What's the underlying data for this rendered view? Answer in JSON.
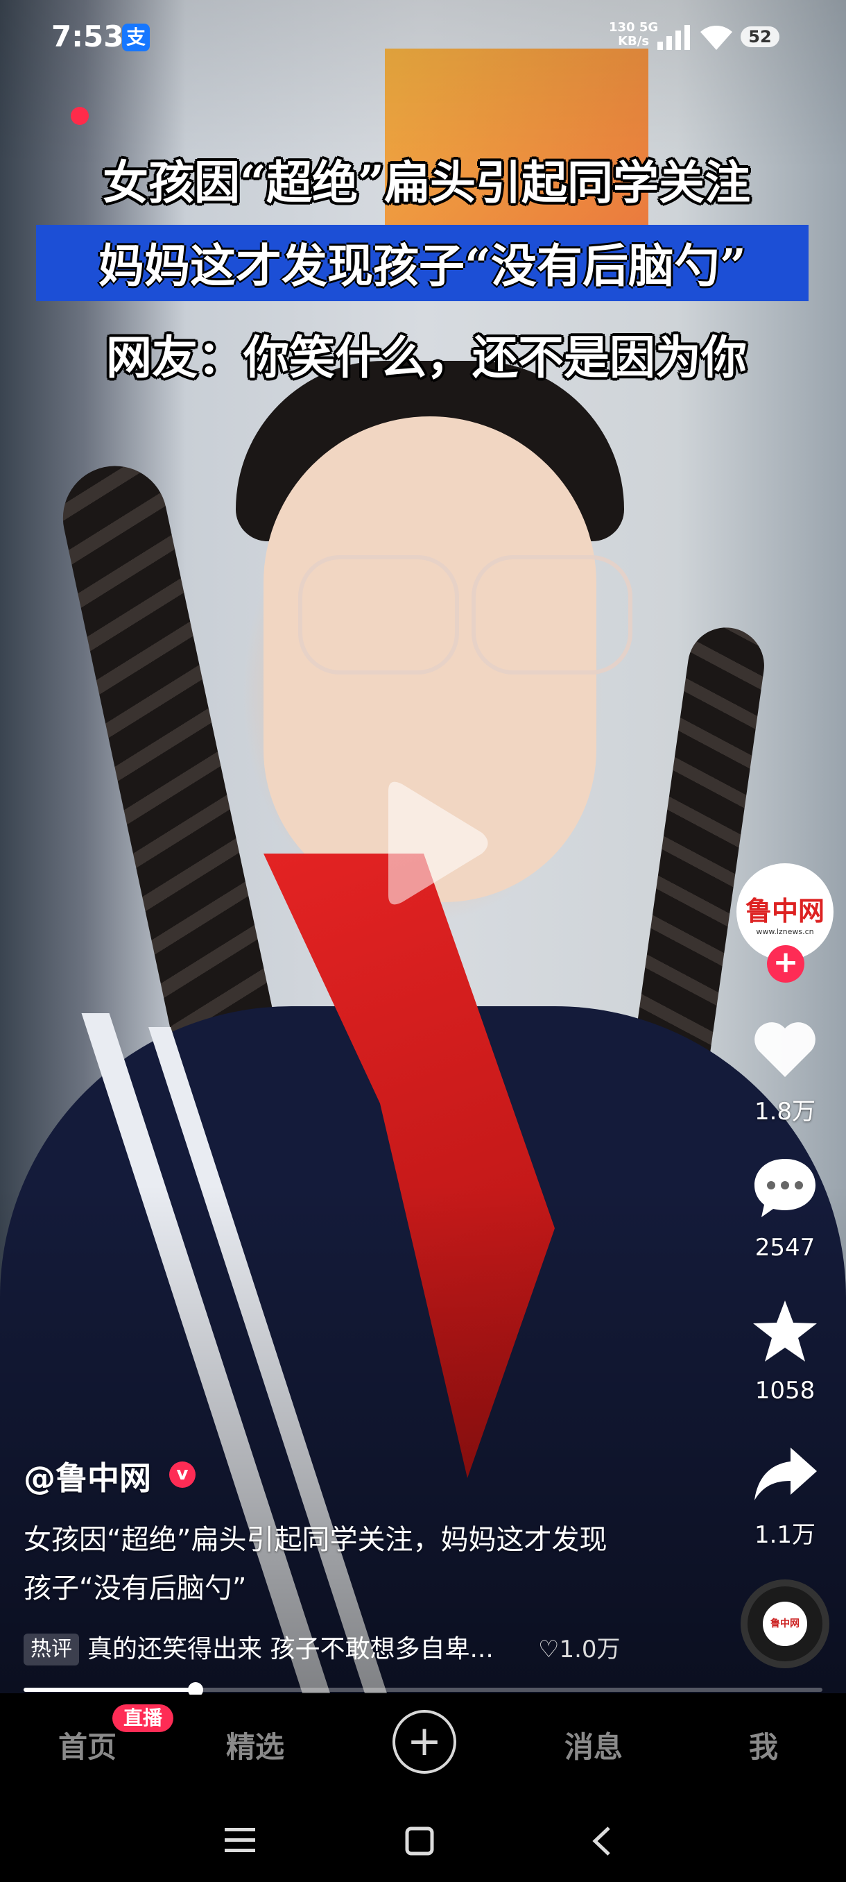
{
  "status_bar": {
    "time": "7:53",
    "alipay_glyph": "支",
    "net_speed_value": "130",
    "net_speed_unit": "KB/s",
    "network_type": "5G",
    "battery": "52"
  },
  "video": {
    "caption_line1": "女孩因“超绝”扁头引起同学关注",
    "caption_line2": "妈妈这才发现孩子“没有后脑勺”",
    "caption_line3": "网友：你笑什么，还不是因为你"
  },
  "author_avatar": {
    "logo_text": "鲁中网",
    "logo_sub": "www.lznews.cn"
  },
  "actions": {
    "likes": "1.8万",
    "comments": "2547",
    "favorites": "1058",
    "shares": "1.1万"
  },
  "post": {
    "author": "@鲁中网",
    "verified_glyph": "v",
    "description": "女孩因“超绝”扁头引起同学关注，妈妈这才发现孩子“没有后脑勺”",
    "hot_comment_tag": "热评",
    "hot_comment_text": "真的还笑得出来 孩子不敢想多自卑...",
    "hot_comment_likes": "♡1.0万"
  },
  "playback": {
    "progress": 0.215
  },
  "tabbar": {
    "home": "首页",
    "live_badge": "直播",
    "featured": "精选",
    "create": "+",
    "messages": "消息",
    "me": "我"
  },
  "colors": {
    "accent": "#fe2c55",
    "caption_highlight": "#1c4fd6"
  },
  "icons": {
    "like": "heart-icon",
    "comment": "comment-icon",
    "favorite": "star-icon",
    "share": "share-icon",
    "play": "play-icon",
    "nav_menu": "menu-icon",
    "nav_home": "square-icon",
    "nav_back": "back-icon"
  }
}
